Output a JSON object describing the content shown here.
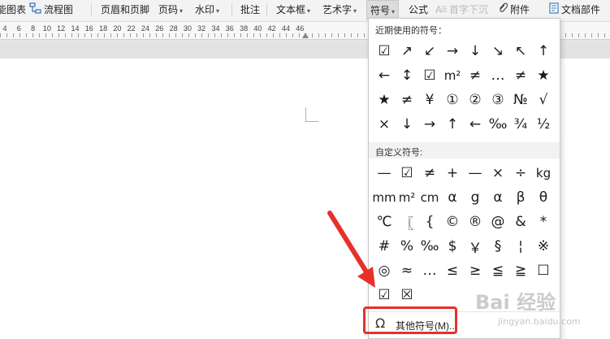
{
  "toolbar": {
    "chart": "能图表",
    "flowchart": "流程图",
    "header_footer": "页眉和页脚",
    "page_number": "页码",
    "watermark": "水印",
    "comment": "批注",
    "textbox": "文本框",
    "wordart": "艺术字",
    "symbol": "符号",
    "formula": "公式",
    "dropcap": "首字下沉",
    "attachment": "附件",
    "doc_parts": "文档部件"
  },
  "ruler": {
    "ticks": [
      "4",
      "6",
      "8",
      "10",
      "12",
      "14",
      "16",
      "18",
      "20",
      "22",
      "24",
      "26",
      "28",
      "30",
      "32",
      "34",
      "36",
      "38",
      "40",
      "42",
      "44",
      "46"
    ]
  },
  "symbol_panel": {
    "recent_title": "近期使用的符号：",
    "recent_symbols": [
      "☑",
      "↗",
      "↙",
      "→",
      "↓",
      "↘",
      "↖",
      "↑",
      "←",
      "↕",
      "☑",
      "m²",
      "≠",
      "…",
      "≠",
      "★",
      "★",
      "≠",
      "¥",
      "①",
      "②",
      "③",
      "№",
      "√",
      "×",
      "↓",
      "→",
      "↑",
      "←",
      "‰",
      "¾",
      "½"
    ],
    "custom_title": "自定义符号:",
    "custom_symbols": [
      "—",
      "☑",
      "≠",
      "+",
      "—",
      "×",
      "÷",
      "kg",
      "mm",
      "m²",
      "cm",
      "α",
      "g",
      "α",
      "β",
      "θ",
      "℃",
      "〖",
      "{",
      "©",
      "®",
      "@",
      "&",
      "*",
      "#",
      "%",
      "‰",
      "$",
      "￥",
      "§",
      "¦",
      "※",
      "◎",
      "≈",
      "…",
      "≤",
      "≥",
      "≦",
      "≧",
      "☐",
      "☑",
      "☒"
    ],
    "other_icon": "Ω",
    "other_label": "其他符号(M)..."
  },
  "watermark": {
    "brand": "Bai 经验",
    "url": "jingyan.baidu.com"
  },
  "colors": {
    "annotation": "#e8302a",
    "toolbar_bg": "#f3f3f3",
    "panel_bg": "#ffffff"
  }
}
